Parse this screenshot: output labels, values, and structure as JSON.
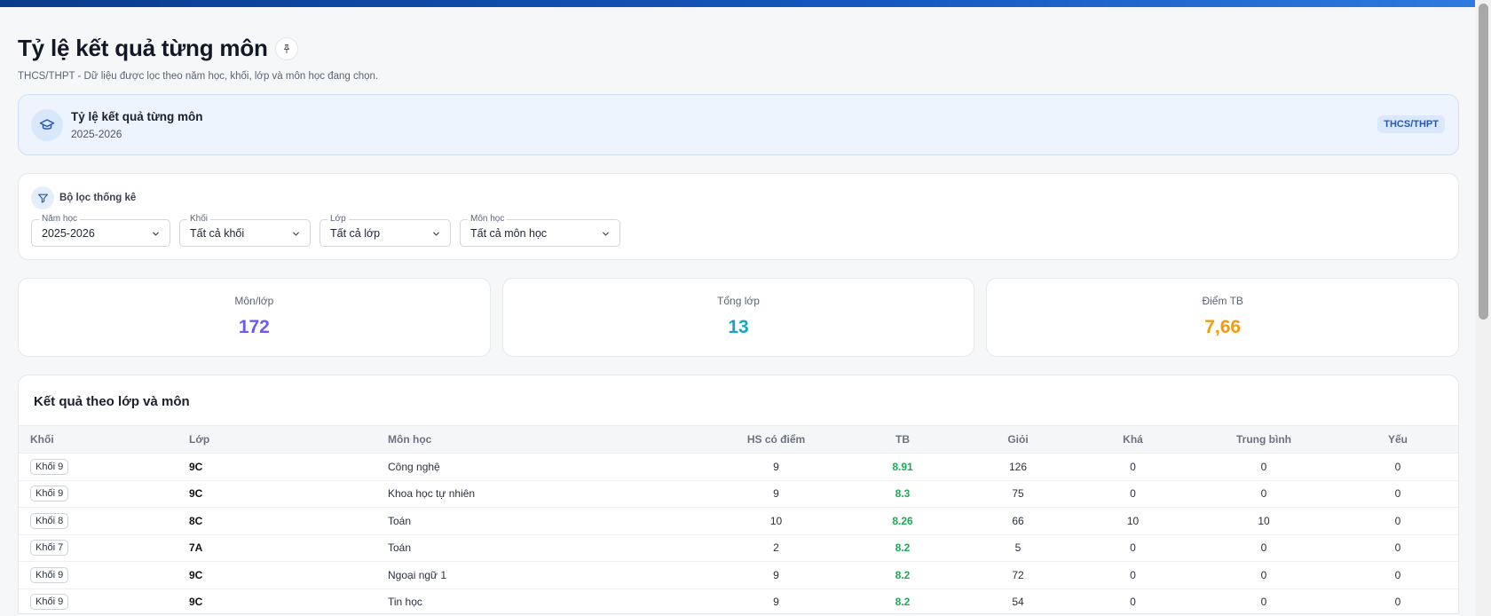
{
  "page": {
    "title": "Tỷ lệ kết quả từng môn",
    "subtitle": "THCS/THPT - Dữ liệu được lọc theo năm học, khối, lớp và môn học đang chọn."
  },
  "banner": {
    "title": "Tỷ lệ kết quả từng môn",
    "year": "2025-2026",
    "badge": "THCS/THPT"
  },
  "filters": {
    "title": "Bộ lọc thống kê",
    "items": [
      {
        "label": "Năm học",
        "value": "2025-2026"
      },
      {
        "label": "Khối",
        "value": "Tất cả khối"
      },
      {
        "label": "Lớp",
        "value": "Tất cả lớp"
      },
      {
        "label": "Môn học",
        "value": "Tất cả môn học"
      }
    ]
  },
  "stats": [
    {
      "label": "Môn/lớp",
      "value": "172",
      "color": "#6a5cf0"
    },
    {
      "label": "Tổng lớp",
      "value": "13",
      "color": "#17a6c9"
    },
    {
      "label": "Điểm TB",
      "value": "7,66",
      "color": "#f29a12"
    }
  ],
  "table": {
    "title": "Kết quả theo lớp và môn",
    "columns": [
      "Khối",
      "Lớp",
      "Môn học",
      "HS có điểm",
      "TB",
      "Giỏi",
      "Khá",
      "Trung bình",
      "Yếu"
    ],
    "rows": [
      [
        "Khối 9",
        "9C",
        "Công nghệ",
        "9",
        "8.91",
        "126",
        "0",
        "0",
        "0"
      ],
      [
        "Khối 9",
        "9C",
        "Khoa học tự nhiên",
        "9",
        "8.3",
        "75",
        "0",
        "0",
        "0"
      ],
      [
        "Khối 8",
        "8C",
        "Toán",
        "10",
        "8.26",
        "66",
        "10",
        "10",
        "0"
      ],
      [
        "Khối 7",
        "7A",
        "Toán",
        "2",
        "8.2",
        "5",
        "0",
        "0",
        "0"
      ],
      [
        "Khối 9",
        "9C",
        "Ngoại ngữ 1",
        "9",
        "8.2",
        "72",
        "0",
        "0",
        "0"
      ],
      [
        "Khối 9",
        "9C",
        "Tin học",
        "9",
        "8.2",
        "54",
        "0",
        "0",
        "0"
      ]
    ]
  }
}
